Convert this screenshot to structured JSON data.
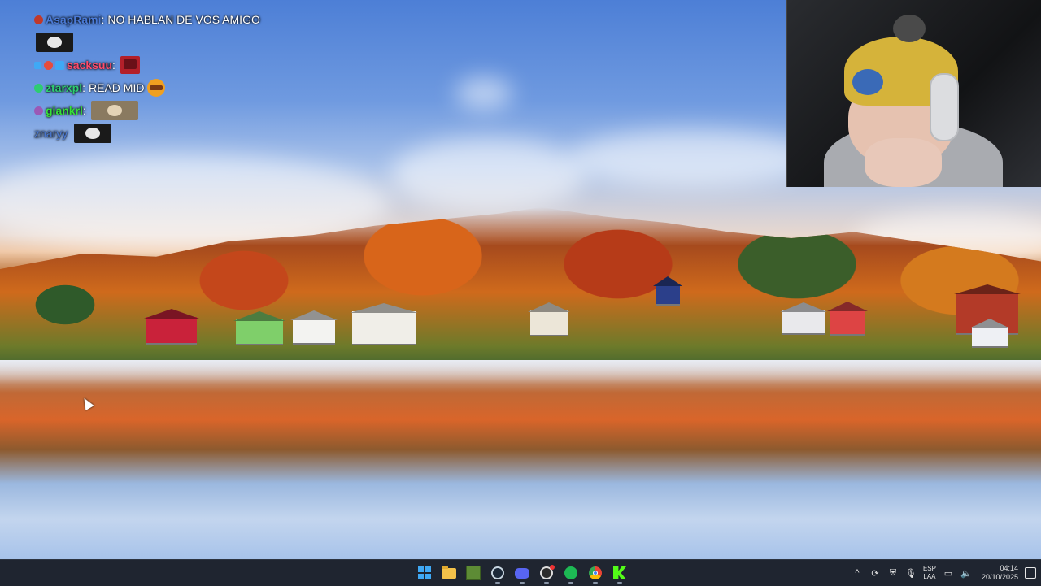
{
  "chat": {
    "messages": [
      {
        "user": "AsapRami",
        "separator": ":",
        "text": "NO HABLAN DE VOS AMIGO",
        "user_color": "#4b7bd8",
        "badges": [
          "#c0392b"
        ]
      },
      {
        "user": "",
        "separator": "",
        "text": "",
        "emote": "cat-emote",
        "user_color": "#ffffff",
        "badges": []
      },
      {
        "user": "sacksuu",
        "separator": ":",
        "text": "",
        "emote": "red-box-emote",
        "user_color": "#ff4d6d",
        "badges": [
          "#3fa9f5",
          "#e74c3c",
          "#3fa9f5"
        ]
      },
      {
        "user": "ztarxpl",
        "separator": ":",
        "text": "READ MID",
        "emote": "burger-emote",
        "user_color": "#2ecc71",
        "badges": [
          "#2ecc71"
        ]
      },
      {
        "user": "giankrl",
        "separator": ":",
        "text": "",
        "emote": "face-emote",
        "user_color": "#37e03a",
        "badges": [
          "#9b59b6"
        ]
      },
      {
        "user": "znaryy",
        "separator": "",
        "text": "",
        "emote": "cat-emote",
        "user_color": "#4b7bd8",
        "badges": []
      }
    ]
  },
  "webcam": {
    "label": "webcam-overlay"
  },
  "taskbar": {
    "apps": [
      {
        "name": "start-icon",
        "running": false
      },
      {
        "name": "file-explorer-icon",
        "running": false
      },
      {
        "name": "minecraft-icon",
        "running": false
      },
      {
        "name": "steam-icon",
        "running": true
      },
      {
        "name": "discord-icon",
        "running": true
      },
      {
        "name": "obs-icon",
        "running": true
      },
      {
        "name": "spotify-icon",
        "running": true
      },
      {
        "name": "chrome-icon",
        "running": true
      },
      {
        "name": "kick-icon",
        "running": true
      }
    ],
    "tray": {
      "lang_top": "ESP",
      "lang_bottom": "LAA",
      "time": "04:14",
      "date": "20/10/2025"
    }
  }
}
